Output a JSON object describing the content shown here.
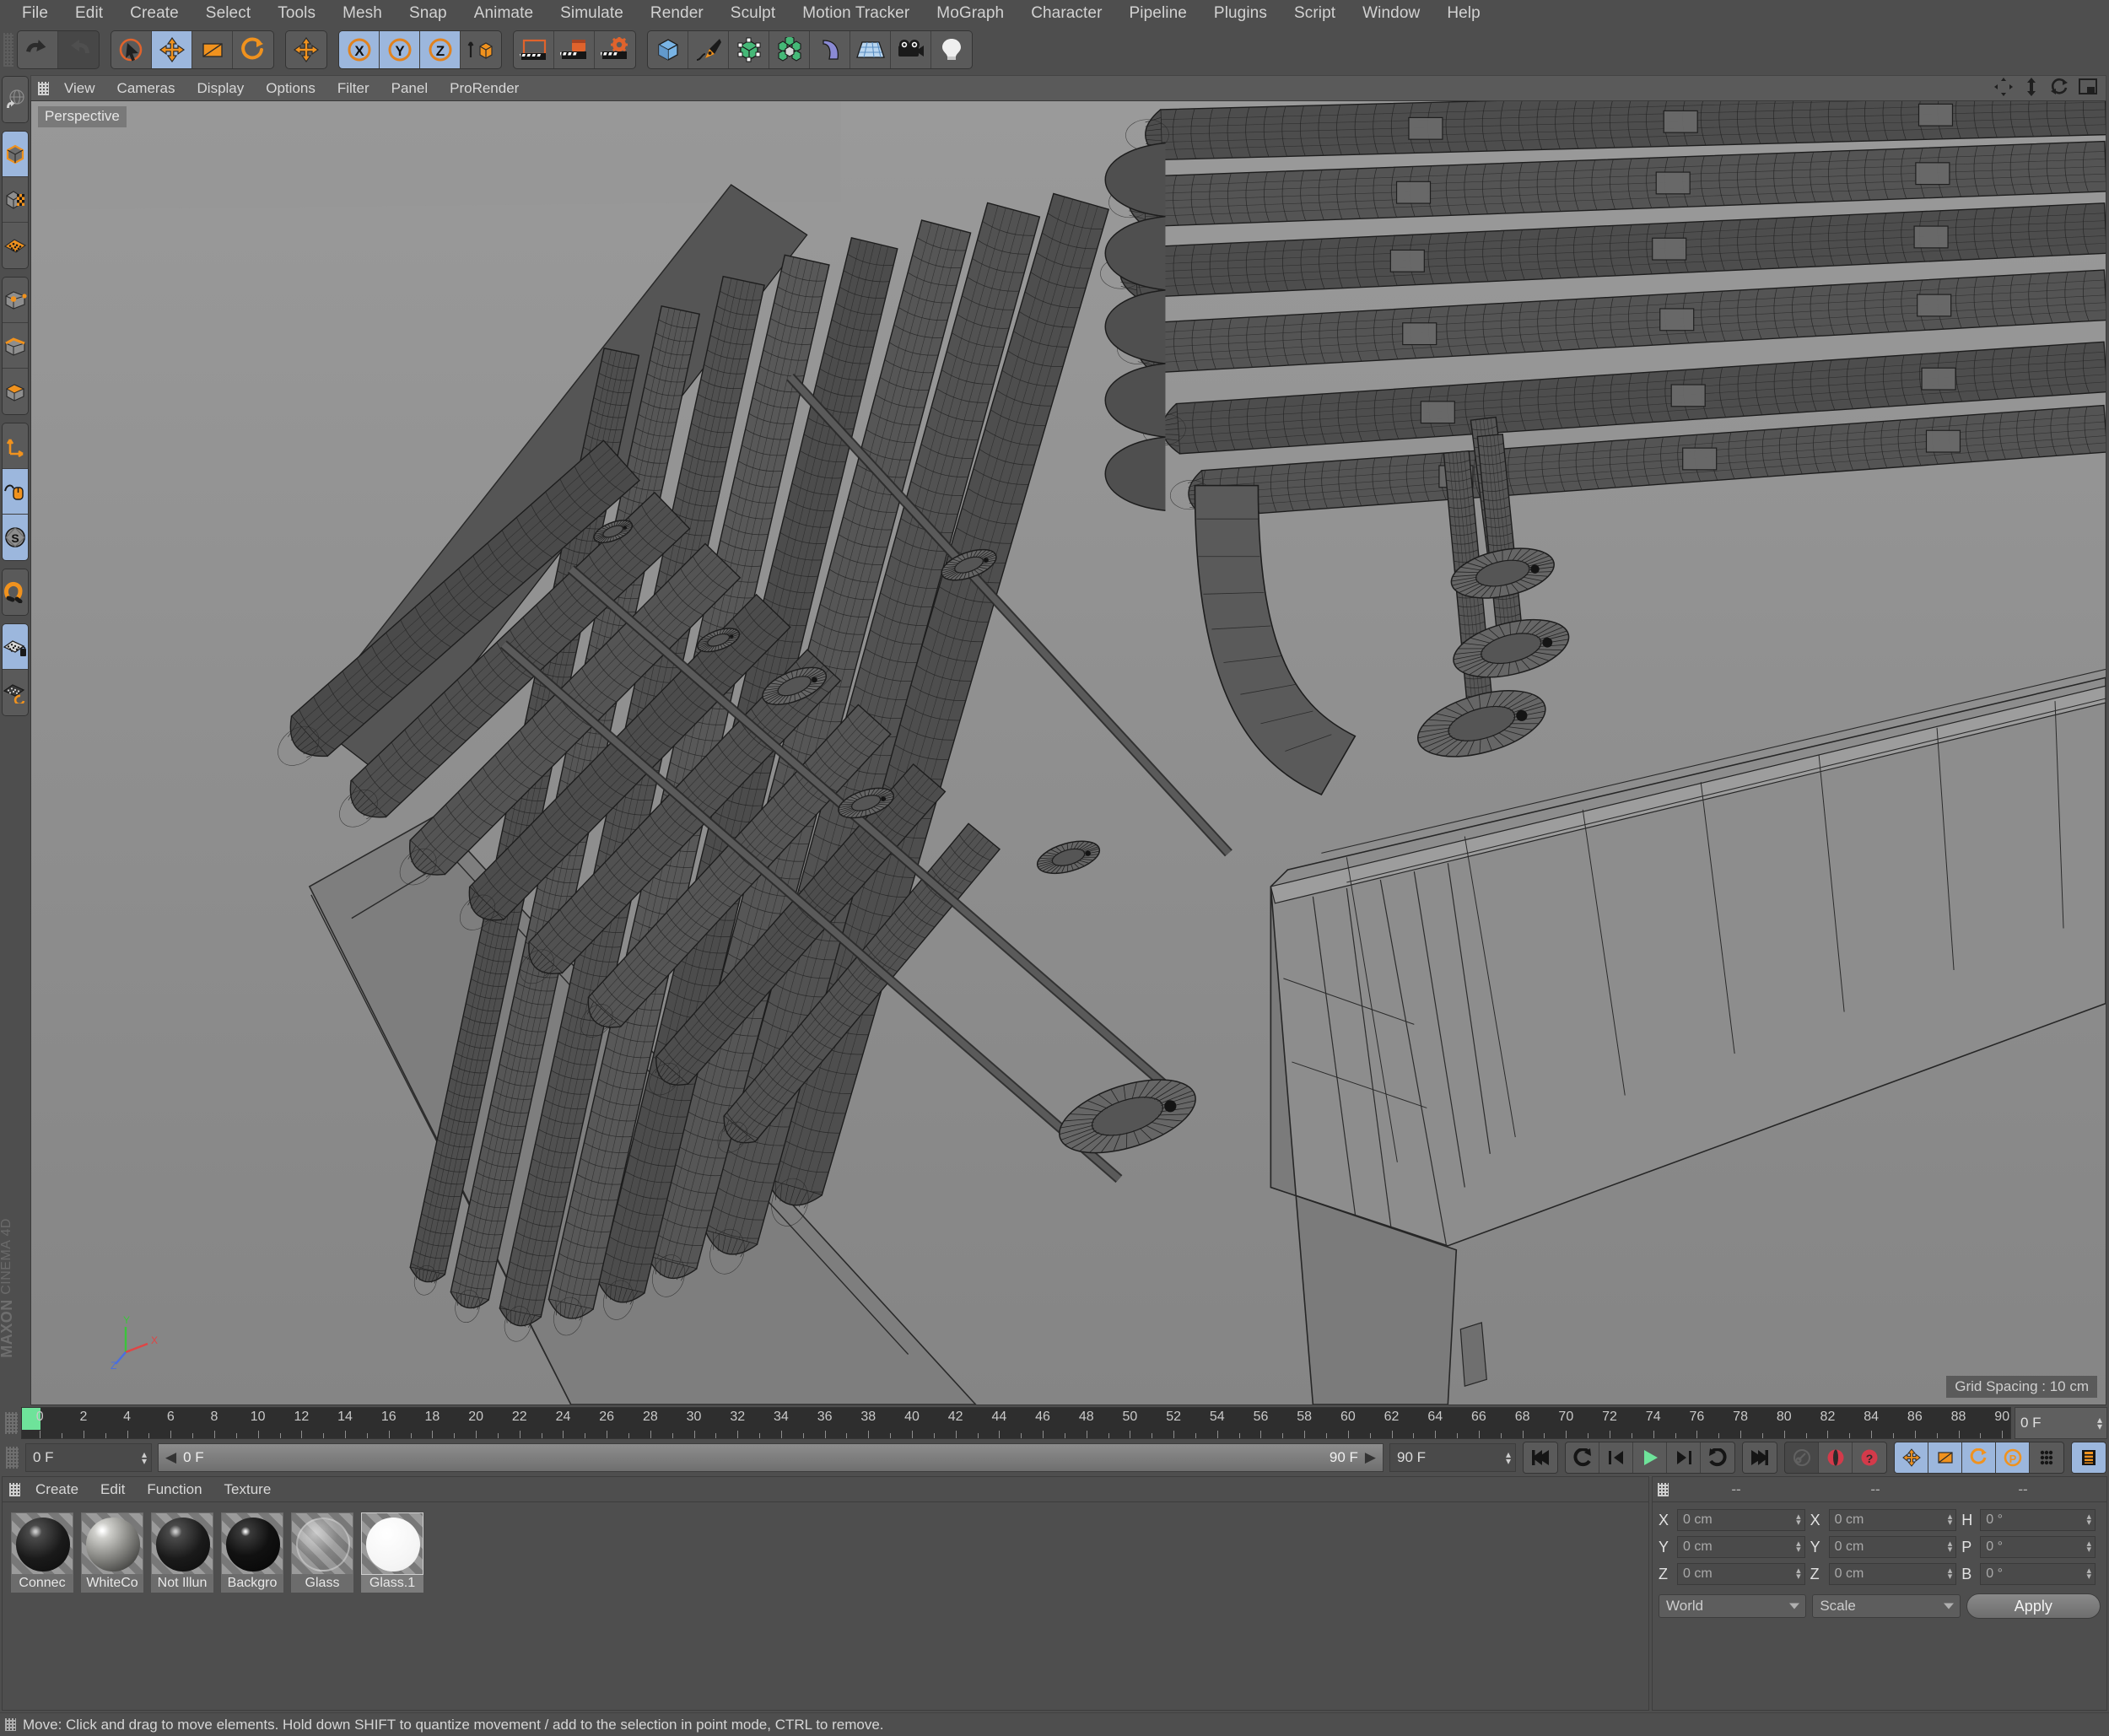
{
  "app": {
    "brand_line1": "MAXON",
    "brand_line2": "CINEMA 4D"
  },
  "menubar": {
    "items": [
      {
        "label": "File"
      },
      {
        "label": "Edit"
      },
      {
        "label": "Create"
      },
      {
        "label": "Select"
      },
      {
        "label": "Tools"
      },
      {
        "label": "Mesh"
      },
      {
        "label": "Snap"
      },
      {
        "label": "Animate"
      },
      {
        "label": "Simulate"
      },
      {
        "label": "Render"
      },
      {
        "label": "Sculpt"
      },
      {
        "label": "Motion Tracker"
      },
      {
        "label": "MoGraph"
      },
      {
        "label": "Character"
      },
      {
        "label": "Pipeline"
      },
      {
        "label": "Plugins"
      },
      {
        "label": "Script"
      },
      {
        "label": "Window"
      },
      {
        "label": "Help"
      }
    ]
  },
  "toolbar": {
    "groups": [
      {
        "name": "history",
        "buttons": [
          {
            "icon": "undo-icon",
            "active": false,
            "dim": false
          },
          {
            "icon": "redo-icon",
            "active": false,
            "dim": true
          }
        ]
      },
      {
        "name": "transform-tools",
        "buttons": [
          {
            "icon": "select-cursor-icon",
            "active": false,
            "dim": false
          },
          {
            "icon": "move-tool-icon",
            "active": true,
            "dim": false
          },
          {
            "icon": "scale-tool-icon",
            "active": false,
            "dim": false
          },
          {
            "icon": "rotate-tool-icon",
            "active": false,
            "dim": false
          }
        ]
      },
      {
        "name": "move-mode",
        "buttons": [
          {
            "icon": "move-axis-icon",
            "active": false,
            "dim": false
          }
        ]
      },
      {
        "name": "axis-locks",
        "buttons": [
          {
            "icon": "lock-x-axis-icon",
            "active": true,
            "dim": false
          },
          {
            "icon": "lock-y-axis-icon",
            "active": true,
            "dim": false
          },
          {
            "icon": "lock-z-axis-icon",
            "active": true,
            "dim": false
          },
          {
            "icon": "world-object-coordinate-icon",
            "active": false,
            "dim": false
          }
        ]
      },
      {
        "name": "render",
        "buttons": [
          {
            "icon": "render-view-icon",
            "active": false,
            "dim": false
          },
          {
            "icon": "render-to-picture-viewer-icon",
            "active": false,
            "dim": false
          },
          {
            "icon": "render-settings-icon",
            "active": false,
            "dim": false
          }
        ]
      },
      {
        "name": "create-objects",
        "buttons": [
          {
            "icon": "cube-primitive-icon",
            "active": false,
            "dim": false
          },
          {
            "icon": "spline-pen-icon",
            "active": false,
            "dim": false
          },
          {
            "icon": "generator-nurbs-icon",
            "active": false,
            "dim": false
          },
          {
            "icon": "mograph-array-icon",
            "active": false,
            "dim": false
          },
          {
            "icon": "deformer-bend-icon",
            "active": false,
            "dim": false
          },
          {
            "icon": "floor-environment-icon",
            "active": false,
            "dim": false
          },
          {
            "icon": "camera-icon",
            "active": false,
            "dim": false
          },
          {
            "icon": "light-icon",
            "active": false,
            "dim": false
          }
        ]
      }
    ]
  },
  "leftbar": {
    "groups": [
      {
        "name": "undo-view-group",
        "buttons": [
          {
            "icon": "undo-view-icon",
            "active": false
          }
        ]
      },
      {
        "name": "selection-modes",
        "buttons": [
          {
            "icon": "model-mode-icon",
            "active": true
          },
          {
            "icon": "texture-mode-icon",
            "active": false
          },
          {
            "icon": "workplane-mode-icon",
            "active": false
          }
        ]
      },
      {
        "name": "component-modes",
        "buttons": [
          {
            "icon": "points-mode-icon",
            "active": false
          },
          {
            "icon": "edges-mode-icon",
            "active": false
          },
          {
            "icon": "polygons-mode-icon",
            "active": false
          }
        ]
      },
      {
        "name": "axis-tools",
        "buttons": [
          {
            "icon": "enable-axis-modification-icon",
            "active": false
          },
          {
            "icon": "viewport-solo-icon",
            "active": true
          },
          {
            "icon": "soft-selection-icon",
            "active": true
          }
        ]
      },
      {
        "name": "snap-tools",
        "buttons": [
          {
            "icon": "magnet-snap-icon",
            "active": false
          }
        ]
      },
      {
        "name": "workplane-tools",
        "buttons": [
          {
            "icon": "workplane-lock-icon",
            "active": true
          },
          {
            "icon": "workplane-rotate-icon",
            "active": false
          }
        ]
      }
    ]
  },
  "viewport": {
    "menu": [
      "View",
      "Cameras",
      "Display",
      "Options",
      "Filter",
      "Panel",
      "ProRender"
    ],
    "label": "Perspective",
    "grid_spacing": "Grid Spacing : 10 cm",
    "controls": [
      "pan-view-icon",
      "dolly-view-icon",
      "rotate-view-icon",
      "maximize-view-icon"
    ],
    "axis_labels": {
      "x": "X",
      "y": "Y",
      "z": "Z"
    },
    "background_color": "#8a8a8a",
    "wire_color": "#1e1e1e"
  },
  "timeline": {
    "start_frame": "0 F",
    "end_frame": "90 F",
    "current_frame": "0 F",
    "preview_start": "0 F",
    "preview_end": "90 F",
    "current_frame_right": "0 F",
    "ticks": [
      0,
      2,
      4,
      6,
      8,
      10,
      12,
      14,
      16,
      18,
      20,
      22,
      24,
      26,
      28,
      30,
      32,
      34,
      36,
      38,
      40,
      42,
      44,
      46,
      48,
      50,
      52,
      54,
      56,
      58,
      60,
      62,
      64,
      66,
      68,
      70,
      72,
      74,
      76,
      78,
      80,
      82,
      84,
      86,
      88,
      90
    ],
    "playhead_color": "#6ee39a"
  },
  "transport": {
    "buttons": [
      {
        "icon": "go-to-start-icon",
        "active": false,
        "dim": false
      },
      {
        "icon": "previous-keyframe-icon",
        "active": false,
        "dim": false
      },
      {
        "icon": "previous-frame-icon",
        "active": false,
        "dim": false
      },
      {
        "icon": "play-icon",
        "active": false,
        "dim": false
      },
      {
        "icon": "next-frame-icon",
        "active": false,
        "dim": false
      },
      {
        "icon": "next-keyframe-icon",
        "active": false,
        "dim": false
      },
      {
        "icon": "go-to-end-icon",
        "active": false,
        "dim": false
      },
      {
        "icon": "autokey-link-icon",
        "active": false,
        "dim": true
      },
      {
        "icon": "record-active-objects-icon",
        "active": false,
        "dim": false
      },
      {
        "icon": "autokeying-icon",
        "active": false,
        "dim": false
      },
      {
        "icon": "key-position-icon",
        "active": true,
        "dim": false
      },
      {
        "icon": "key-scale-icon",
        "active": true,
        "dim": false
      },
      {
        "icon": "key-rotation-icon",
        "active": true,
        "dim": false
      },
      {
        "icon": "key-parameter-icon",
        "active": true,
        "dim": false
      },
      {
        "icon": "key-point-level-icon",
        "active": false,
        "dim": false
      },
      {
        "icon": "timeline-strip-icon",
        "active": true,
        "dim": false
      }
    ]
  },
  "materials": {
    "menu": [
      "Create",
      "Edit",
      "Function",
      "Texture"
    ],
    "items": [
      {
        "name": "Connect",
        "label": "Connec",
        "color": "#151515",
        "type": "matte-dark",
        "selected": false
      },
      {
        "name": "WhiteCol",
        "label": "WhiteCo",
        "color": "#8e8e8a",
        "type": "glossy-grey",
        "selected": false
      },
      {
        "name": "Not Illum",
        "label": "Not Illun",
        "color": "#1c1c1c",
        "type": "matte-dark",
        "selected": false
      },
      {
        "name": "Background",
        "label": "Backgro",
        "color": "#0d0d0d",
        "type": "matte-black",
        "selected": false
      },
      {
        "name": "Glass",
        "label": "Glass",
        "color": "#a7a7a7",
        "type": "transparent",
        "selected": false
      },
      {
        "name": "Glass.1",
        "label": "Glass.1",
        "color": "#ffffff",
        "type": "white",
        "selected": true
      }
    ]
  },
  "coordinates": {
    "headers": [
      "--",
      "--",
      "--"
    ],
    "position": [
      {
        "label": "X",
        "value": "0 cm"
      },
      {
        "label": "Y",
        "value": "0 cm"
      },
      {
        "label": "Z",
        "value": "0 cm"
      }
    ],
    "size": [
      {
        "label": "X",
        "value": "0 cm"
      },
      {
        "label": "Y",
        "value": "0 cm"
      },
      {
        "label": "Z",
        "value": "0 cm"
      }
    ],
    "rotation": [
      {
        "label": "H",
        "value": "0 °"
      },
      {
        "label": "P",
        "value": "0 °"
      },
      {
        "label": "B",
        "value": "0 °"
      }
    ],
    "coord_system": "World",
    "size_mode": "Scale",
    "apply_label": "Apply"
  },
  "statusbar": {
    "message": "Move: Click and drag to move elements. Hold down SHIFT to quantize movement / add to the selection in point mode, CTRL to remove."
  },
  "colors": {
    "accent_orange": "#f0921e",
    "accent_blue": "#9cb7dd",
    "panel_bg": "#4e4e4e",
    "viewport_bg": "#8a8a8a",
    "green_play": "#6ee39a"
  }
}
